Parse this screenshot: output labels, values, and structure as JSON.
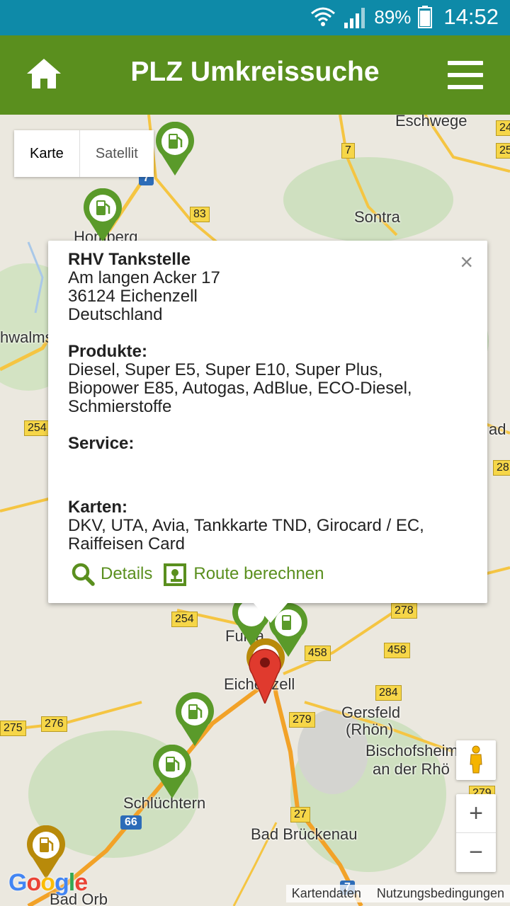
{
  "statusbar": {
    "battery_pct": "89%",
    "time": "14:52"
  },
  "appbar": {
    "title": "PLZ Umkreissuche"
  },
  "map": {
    "maptype": {
      "karte": "Karte",
      "satellit": "Satellit"
    },
    "labels": {
      "eschwege": "Eschwege",
      "sontra": "Sontra",
      "homberg": "Homberg",
      "schwalmstadt": "hwalms",
      "fulda": "Fulda",
      "eichenzell": "Eichenzell",
      "gersfeld": "Gersfeld",
      "rhoen": "(Rhön)",
      "bischofsheim": "Bischofsheim",
      "an_der_rhoen": "an der Rhö",
      "schluechtern": "Schlüchtern",
      "bad_brueckenau": "Bad Brückenau",
      "bad_orb": "Bad Orb",
      "ad": "ad"
    },
    "shields": {
      "s7a": "7",
      "s83": "83",
      "s254a": "254",
      "s254b": "254",
      "s278": "278",
      "s458a": "458",
      "s458b": "458",
      "s284": "284",
      "s279a": "279",
      "s276": "276",
      "s275": "275",
      "s27": "27",
      "s279b": "279",
      "s28": "28",
      "s24": "24",
      "s25": "25"
    },
    "blue_shields": {
      "a7": "7",
      "a66": "66",
      "a7b": "7"
    },
    "google": "Google",
    "attribution": {
      "kartendaten": "Kartendaten",
      "nutzung": "Nutzungsbedingungen"
    },
    "zoom": {
      "in": "+",
      "out": "−"
    }
  },
  "infowindow": {
    "name": "RHV Tankstelle",
    "street": "Am langen Acker 17",
    "city": "36124 Eichenzell",
    "country": "Deutschland",
    "products_heading": "Produkte:",
    "products": "Diesel, Super E5, Super E10, Super Plus, Biopower E85, Autogas, AdBlue, ECO-Diesel, Schmierstoffe",
    "service_heading": "Service:",
    "service": "",
    "cards_heading": "Karten:",
    "cards": "DKV, UTA, Avia, Tankkarte TND, Girocard / EC, Raiffeisen Card",
    "details_link": "Details",
    "route_link": "Route berechnen",
    "close": "×"
  },
  "colors": {
    "statusbar": "#0e8aa8",
    "appbar": "#5a8f1e",
    "pin_green": "#5a9a2a",
    "pin_gold": "#b88a0a",
    "marker_red": "#e03a2e"
  }
}
